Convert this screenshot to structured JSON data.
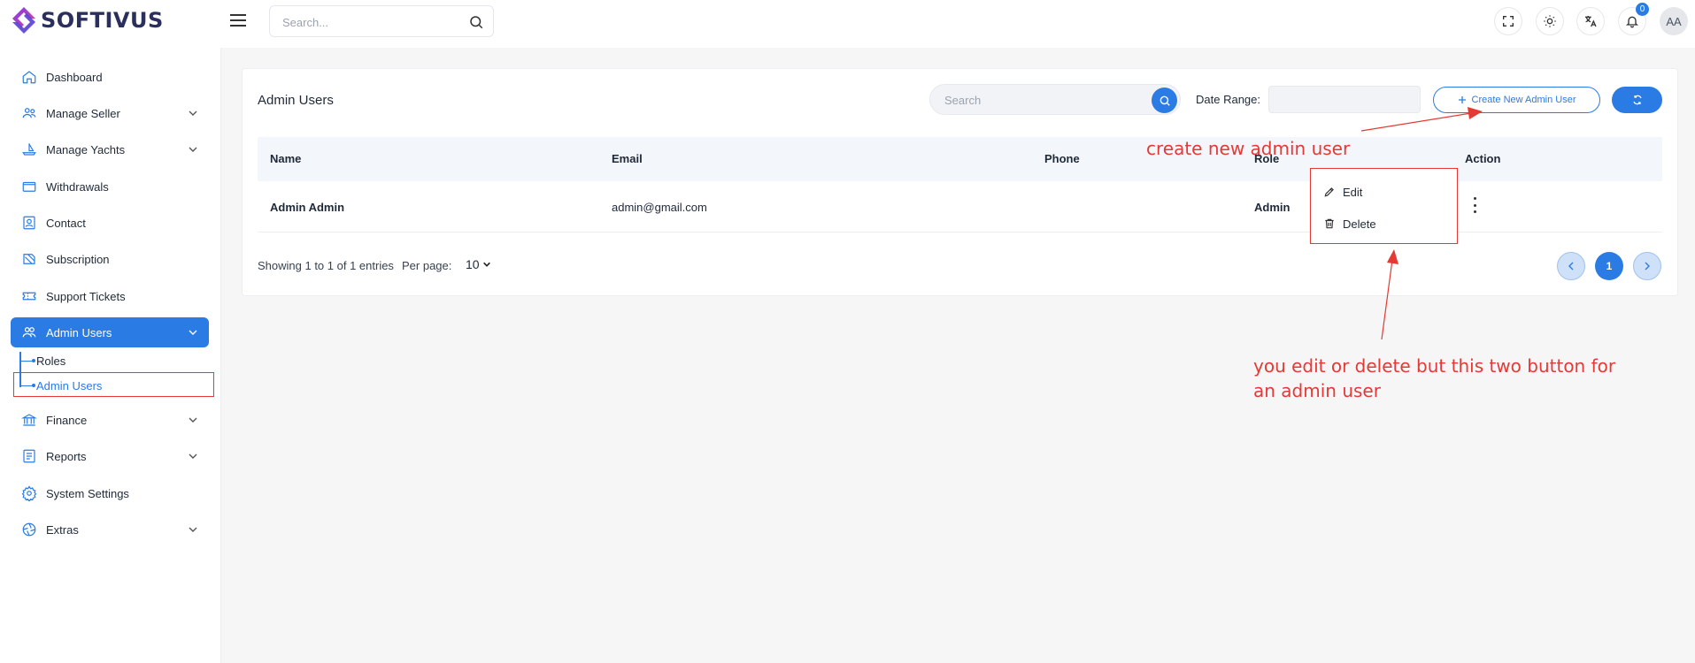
{
  "header": {
    "brand": "SOFTIVUS",
    "search_placeholder": "Search...",
    "notification_count": "0",
    "avatar_initials": "AA"
  },
  "sidebar": {
    "items": [
      {
        "label": "Dashboard",
        "icon": "home-icon"
      },
      {
        "label": "Manage Seller",
        "icon": "users-icon"
      },
      {
        "label": "Manage Yachts",
        "icon": "yacht-icon"
      },
      {
        "label": "Withdrawals",
        "icon": "wallet-icon"
      },
      {
        "label": "Contact",
        "icon": "contact-icon"
      },
      {
        "label": "Subscription",
        "icon": "subscription-icon"
      },
      {
        "label": "Support Tickets",
        "icon": "ticket-icon"
      },
      {
        "label": "Admin Users",
        "icon": "admin-users-icon"
      },
      {
        "label": "Finance",
        "icon": "bank-icon"
      },
      {
        "label": "Reports",
        "icon": "report-icon"
      },
      {
        "label": "System Settings",
        "icon": "gear-icon"
      },
      {
        "label": "Extras",
        "icon": "aperture-icon"
      }
    ],
    "admin_sub": [
      "Roles",
      "Admin Users"
    ]
  },
  "page": {
    "title": "Admin Users",
    "search_placeholder": "Search",
    "date_range_label": "Date Range:",
    "create_button": "Create New Admin User"
  },
  "table": {
    "columns": [
      "Name",
      "Email",
      "Phone",
      "Role",
      "Action"
    ],
    "rows": [
      {
        "name": "Admin Admin",
        "email": "admin@gmail.com",
        "phone": "",
        "role": "Admin"
      }
    ]
  },
  "footer": {
    "showing": "Showing 1 to 1 of 1 entries",
    "per_page_label": "Per page:",
    "per_page_value": "10",
    "current_page": "1"
  },
  "menu": {
    "edit": "Edit",
    "delete": "Delete"
  },
  "annotations": {
    "create_note": "create new admin user",
    "edit_note_line1": "you edit or delete but this two button for",
    "edit_note_line2": "an admin user",
    "color": "#e53935"
  },
  "colors": {
    "primary": "#2a7be4",
    "annotation": "#e53935"
  }
}
